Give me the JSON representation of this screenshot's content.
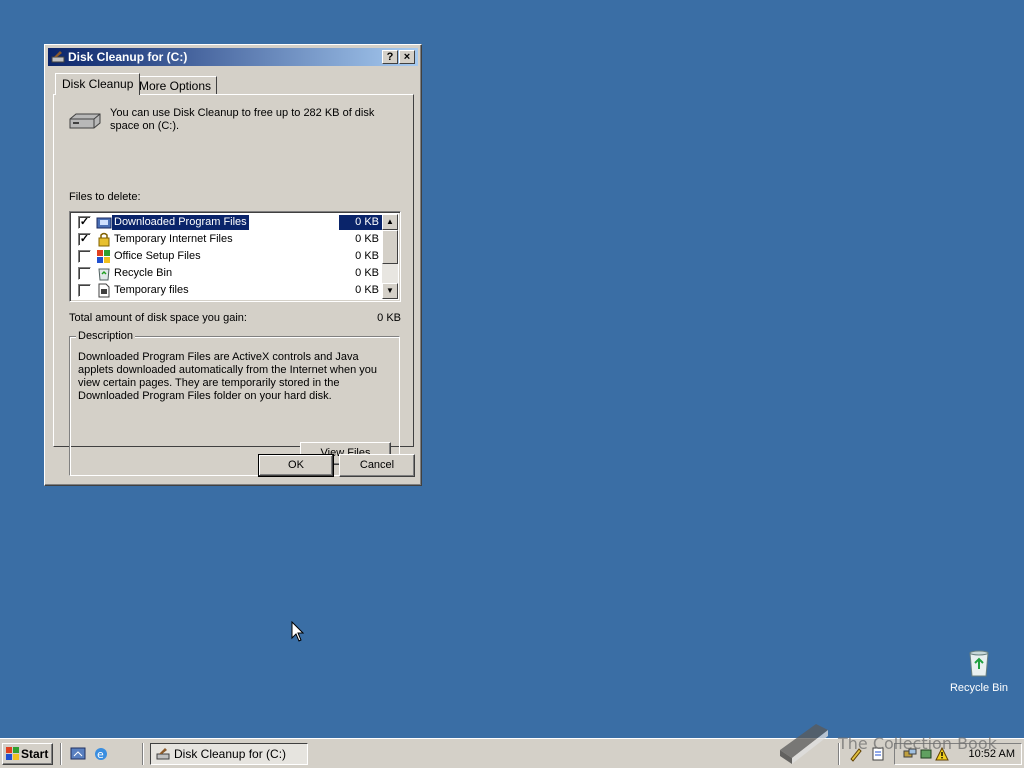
{
  "window": {
    "title": "Disk Cleanup for  (C:)",
    "help_label": "?",
    "close_label": "×"
  },
  "tabs": [
    {
      "label": "Disk Cleanup",
      "active": true
    },
    {
      "label": "More Options",
      "active": false
    }
  ],
  "intro_text": "You can use Disk Cleanup to free up to 282 KB of disk space on  (C:).",
  "files_label": "Files to delete:",
  "files": [
    {
      "name": "Downloaded Program Files",
      "size": "0 KB",
      "checked": true,
      "selected": true,
      "icon": "downloaded-programs-icon"
    },
    {
      "name": "Temporary Internet Files",
      "size": "0 KB",
      "checked": true,
      "selected": false,
      "icon": "lock-icon"
    },
    {
      "name": "Office Setup Files",
      "size": "0 KB",
      "checked": false,
      "selected": false,
      "icon": "office-setup-icon"
    },
    {
      "name": "Recycle Bin",
      "size": "0 KB",
      "checked": false,
      "selected": false,
      "icon": "recycle-bin-icon"
    },
    {
      "name": "Temporary files",
      "size": "0 KB",
      "checked": false,
      "selected": false,
      "icon": "temp-file-icon"
    }
  ],
  "total_label": "Total amount of disk space you gain:",
  "total_value": "0 KB",
  "description": {
    "legend": "Description",
    "text": "Downloaded Program Files are ActiveX controls and Java applets downloaded automatically from the Internet when you view certain pages. They are temporarily stored in the Downloaded Program Files folder on your hard disk.",
    "view_files_label": "View Files"
  },
  "buttons": {
    "ok": "OK",
    "cancel": "Cancel"
  },
  "desktop": {
    "recycle_bin_label": "Recycle Bin"
  },
  "taskbar": {
    "start_label": "Start",
    "task_label": "Disk Cleanup for  (C:)",
    "clock": "10:52 AM"
  },
  "watermark_text": "The Collection Book",
  "colors": {
    "desktop": "#3a6ea5",
    "titlebar": "#0a246a",
    "face": "#d4d0c8",
    "selection": "#0a246a"
  }
}
